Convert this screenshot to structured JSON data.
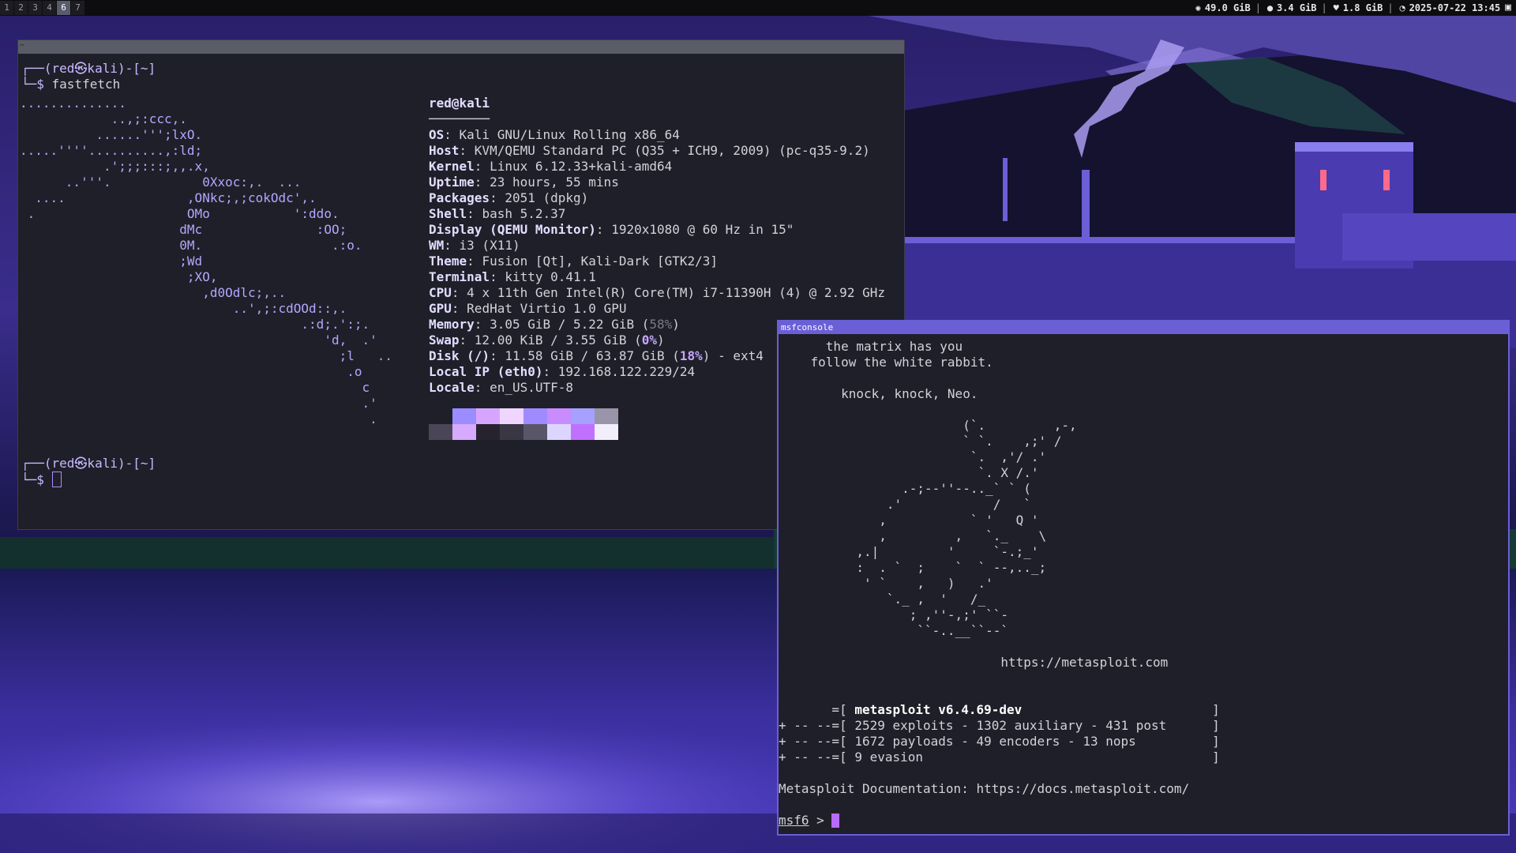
{
  "bar": {
    "workspaces": [
      "1",
      "2",
      "3",
      "4",
      "6",
      "7"
    ],
    "active_workspace": "6",
    "status": [
      {
        "icon": "cpu-icon",
        "glyph": "✺",
        "value": "49.0 GiB"
      },
      {
        "icon": "disk-icon",
        "glyph": "●",
        "value": "3.4 GiB"
      },
      {
        "icon": "memory-icon",
        "glyph": "♥",
        "value": "1.8 GiB"
      },
      {
        "icon": "clock-icon",
        "glyph": "◔",
        "value": "2025-07-22 13:45"
      }
    ],
    "tray_icon": "tray-icon"
  },
  "kitty": {
    "title": "~",
    "prompt_user": "red㉿kali",
    "prompt_dir": "~",
    "command": "fastfetch",
    "logo_lines": [
      "..............",
      "            ..,;:ccc,.",
      "          ......''';lxO.",
      ".....''''..........,:ld;",
      "           .';;;:::;,,.x,",
      "      ..'''.            0Xxoc:,.  ...",
      "  ....                ,ONkc;,;cokOdc',.",
      " .                    OMo           ':ddo.",
      "                     dMc               :OO;",
      "                     0M.                 .:o.",
      "                     ;Wd",
      "                      ;XO,",
      "                        ,d0Odlc;,..",
      "                            ..',;:cdOOd::,.",
      "                                     .:d;.':;.",
      "                                        'd,  .'",
      "                                          ;l   ..",
      "                                           .o",
      "                                             c",
      "                                             .'",
      "                                              ."
    ],
    "user_host": "red@kali",
    "underline": "────────",
    "info": [
      {
        "label": "OS",
        "value": "Kali GNU/Linux Rolling x86_64"
      },
      {
        "label": "Host",
        "value": "KVM/QEMU Standard PC (Q35 + ICH9, 2009) (pc-q35-9.2)"
      },
      {
        "label": "Kernel",
        "value": "Linux 6.12.33+kali-amd64"
      },
      {
        "label": "Uptime",
        "value": "23 hours, 55 mins"
      },
      {
        "label": "Packages",
        "value": "2051 (dpkg)"
      },
      {
        "label": "Shell",
        "value": "bash 5.2.37"
      },
      {
        "label": "Display (QEMU Monitor)",
        "value": "1920x1080 @ 60 Hz in 15\""
      },
      {
        "label": "WM",
        "value": "i3 (X11)"
      },
      {
        "label": "Theme",
        "value": "Fusion [Qt], Kali-Dark [GTK2/3]"
      },
      {
        "label": "Terminal",
        "value": "kitty 0.41.1"
      },
      {
        "label": "CPU",
        "value": "4 x 11th Gen Intel(R) Core(TM) i7-11390H (4) @ 2.92 GHz"
      },
      {
        "label": "GPU",
        "value": "RedHat Virtio 1.0 GPU"
      },
      {
        "label": "Memory",
        "value": "3.05 GiB / 5.22 GiB (",
        "pct": "58%",
        "tail": ")"
      },
      {
        "label": "Swap",
        "value": "12.00 KiB / 3.55 GiB (",
        "pct": "0%",
        "tail": ")"
      },
      {
        "label": "Disk (/)",
        "value": "11.58 GiB / 63.87 GiB (",
        "pct": "18%",
        "tail": ") - ext4"
      },
      {
        "label": "Local IP (eth0)",
        "value": "192.168.122.229/24"
      },
      {
        "label": "Locale",
        "value": "en_US.UTF-8"
      }
    ],
    "palette_row1": [
      "#1f1f29",
      "#9b8cff",
      "#d6a6ff",
      "#f0d6ff",
      "#a08aff",
      "#c88cff",
      "#a6a0ff",
      "#9a94a8"
    ],
    "palette_row2": [
      "#4a4658",
      "#d6aaff",
      "#26232e",
      "#3a3745",
      "#5a566a",
      "#dcd6ff",
      "#c070ff",
      "#f2eefc"
    ],
    "prompt2_user": "red㉿kali",
    "prompt2_dir": "~"
  },
  "msf": {
    "title": "msfconsole",
    "banner": [
      "      the matrix has you",
      "    follow the white rabbit.",
      "",
      "        knock, knock, Neo.",
      "",
      "                        (`.         ,-,",
      "                        ` `.    ,;' /",
      "                         `.  ,'/ .'",
      "                          `. X /.'",
      "                .-;--''--.._` ` (",
      "              .'            /   `",
      "             ,           ` '   Q '",
      "             ,         ,   `._    \\",
      "          ,.|         '     `-.;_'",
      "          :  . `  ;    `  ` --,.._;",
      "           ' `    ,   )   .'",
      "              `._ ,  '   /_",
      "                 ; ,''-,;' ``-",
      "                  ``-..__``--`",
      "",
      "                             https://metasploit.com"
    ],
    "version_lines": [
      {
        "pre": "       =[ ",
        "main": "metasploit v6.4.69-dev",
        "post": "                         ]"
      },
      {
        "pre": "+ -- --=[ ",
        "main": "2529 exploits - 1302 auxiliary - 431 post",
        "post": "      ]"
      },
      {
        "pre": "+ -- --=[ ",
        "main": "1672 payloads - 49 encoders - 13 nops",
        "post": "          ]"
      },
      {
        "pre": "+ -- --=[ ",
        "main": "9 evasion",
        "post": "                                      ]"
      }
    ],
    "doc_line": "Metasploit Documentation: https://docs.metasploit.com/",
    "prompt": "msf6",
    "prompt_sep": " > "
  }
}
